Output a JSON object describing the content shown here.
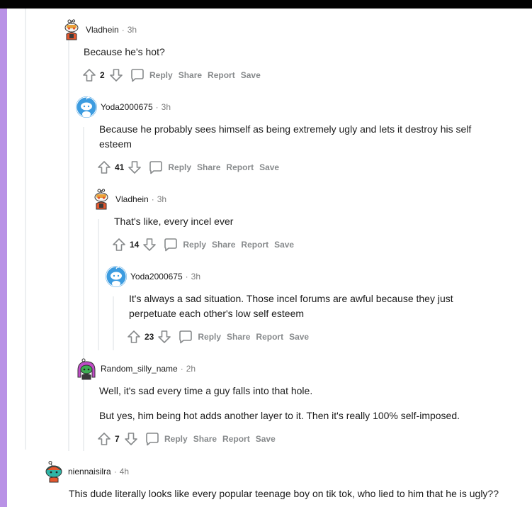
{
  "colors": {
    "accent_bar": "#b992e6",
    "top_bar": "#030303",
    "meta_gray": "#7c7c7c",
    "action_gray": "#878a8c",
    "thread_line": "#edeff1"
  },
  "actions": {
    "reply": "Reply",
    "share": "Share",
    "report": "Report",
    "save": "Save"
  },
  "comments": [
    {
      "author": "Vladhein",
      "time": "3h",
      "avatar_icon": "robot-avatar-icon",
      "body": [
        "Because he's hot?"
      ],
      "votes": "2"
    },
    {
      "author": "Yoda2000675",
      "time": "3h",
      "avatar_icon": "snoo-avatar-icon",
      "body": [
        "Because he probably sees himself as being extremely ugly and lets it destroy his self esteem"
      ],
      "votes": "41"
    },
    {
      "author": "Vladhein",
      "time": "3h",
      "avatar_icon": "robot-avatar-icon",
      "body": [
        "That's like, every incel ever"
      ],
      "votes": "14"
    },
    {
      "author": "Yoda2000675",
      "time": "3h",
      "avatar_icon": "snoo-avatar-icon",
      "body": [
        "It's always a sad situation. Those incel forums are awful because they just perpetuate each other's low self esteem"
      ],
      "votes": "23"
    },
    {
      "author": "Random_silly_name",
      "time": "2h",
      "avatar_icon": "purple-hair-avatar-icon",
      "body": [
        "Well, it's sad every time a guy falls into that hole.",
        "But yes, him being hot adds another layer to it. Then it's really 100% self-imposed."
      ],
      "votes": "7"
    },
    {
      "author": "niennaisilra",
      "time": "4h",
      "avatar_icon": "teal-avatar-icon",
      "body": [
        "This dude literally looks like every popular teenage boy on tik tok, who lied to him that he is ugly??"
      ]
    }
  ]
}
